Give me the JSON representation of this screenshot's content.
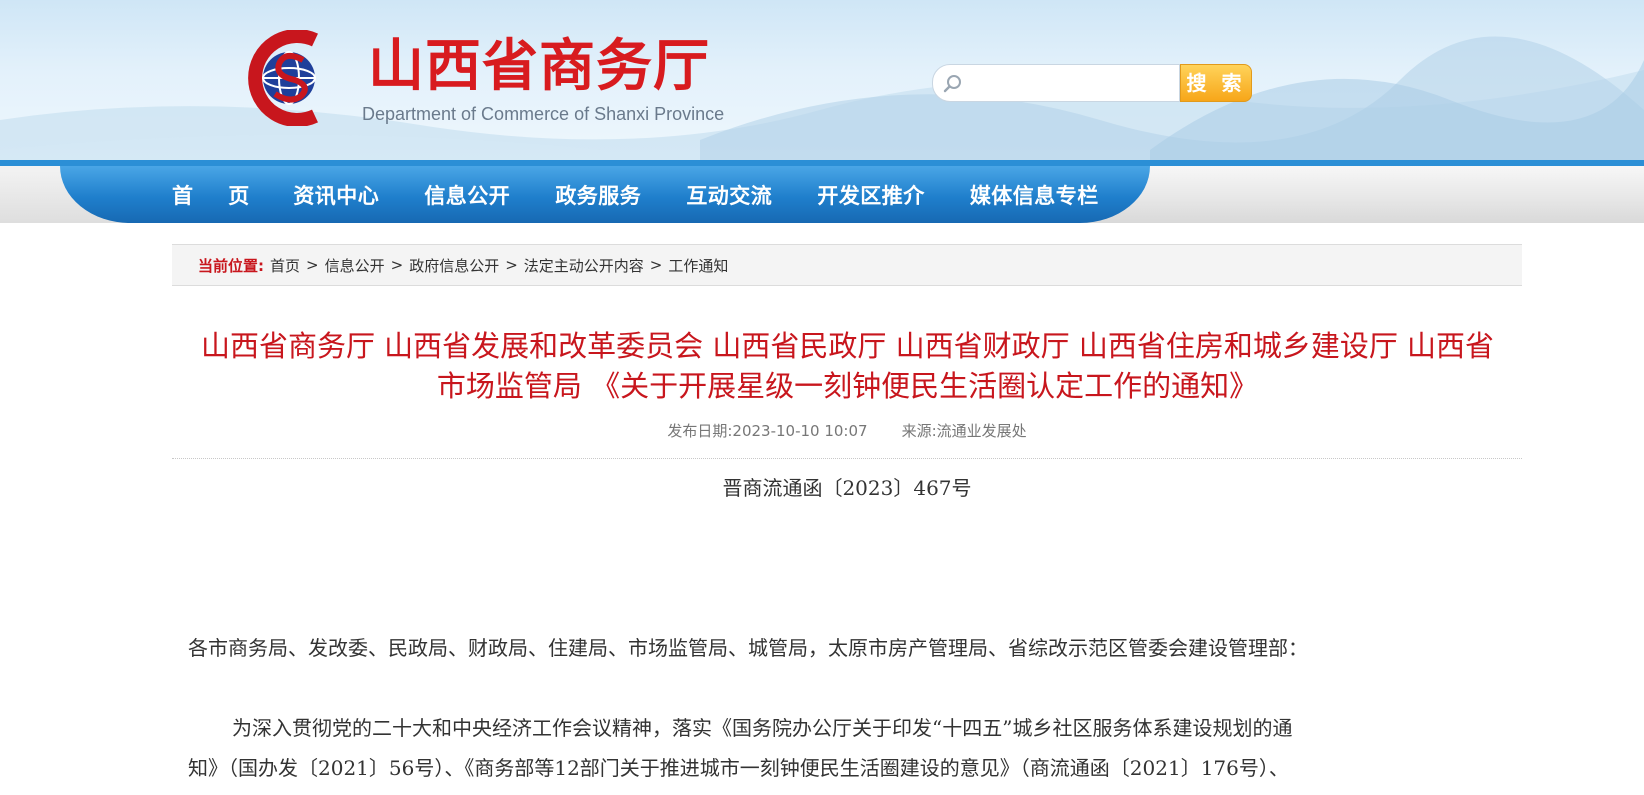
{
  "header": {
    "logo_cn": "山西省商务厅",
    "logo_en": "Department of Commerce of Shanxi Province",
    "search_placeholder": "",
    "search_button": "搜 索"
  },
  "nav": {
    "items": [
      "首 页",
      "资讯中心",
      "信息公开",
      "政务服务",
      "互动交流",
      "开发区推介",
      "媒体信息专栏"
    ]
  },
  "breadcrumb": {
    "label": "当前位置:",
    "items": [
      "首页",
      "信息公开",
      "政府信息公开",
      "法定主动公开内容",
      "工作通知"
    ],
    "separator": ">"
  },
  "article": {
    "title_line1": "山西省商务厅 山西省发展和改革委员会 山西省民政厅 山西省财政厅 山西省住房和城乡建设厅 山西省",
    "title_line2": "市场监管局 《关于开展星级一刻钟便民生活圈认定工作的通知》",
    "publish_label": "发布日期:",
    "publish_date": "2023-10-10 10:07",
    "source_label": "来源:",
    "source": "流通业发展处",
    "doc_number": "晋商流通函〔2023〕467号",
    "para1": "各市商务局、发改委、民政局、财政局、住建局、市场监管局、城管局，太原市房产管理局、省综改示范区管委会建设管理部：",
    "para2_line1": "为深入贯彻党的二十大和中央经济工作会议精神，落实《国务院办公厅关于印发“十四五”城乡社区服务体系建设规划的通",
    "para2_line2": "知》（国办发〔2021〕56号）、《商务部等12部门关于推进城市一刻钟便民生活圈建设的意见》（商流通函〔2021〕176号）、"
  },
  "colors": {
    "brand_red": "#c8161d",
    "nav_blue": "#1f7fcc",
    "search_orange": "#f7a619"
  },
  "icons": {
    "logo": "shanxi-commerce-emblem",
    "search": "magnifier-icon"
  }
}
